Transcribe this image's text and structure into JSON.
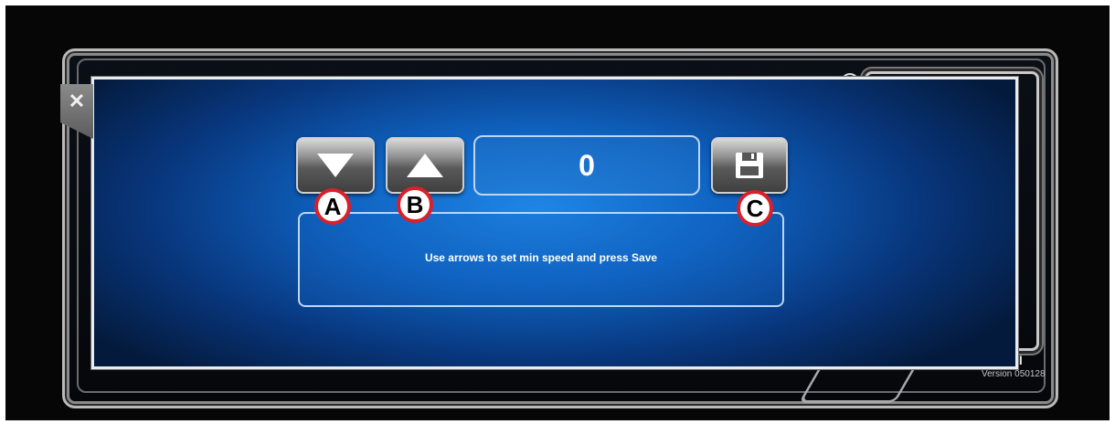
{
  "toolbar": {
    "decrease_icon": "triangle-down-icon",
    "increase_icon": "triangle-up-icon",
    "save_icon": "floppy-disk-icon",
    "value": "0"
  },
  "message": "Use arrows to set min speed and press Save",
  "callouts": {
    "a": "A",
    "b": "B",
    "c": "C"
  },
  "background_screen": {
    "title_fragment": "on II",
    "version": "Version 050128"
  },
  "close_icon": "close-icon",
  "colors": {
    "dialog_blue": "#1f86e6",
    "callout_ring": "#d9202a",
    "frame_silver": "#e9ecef"
  }
}
